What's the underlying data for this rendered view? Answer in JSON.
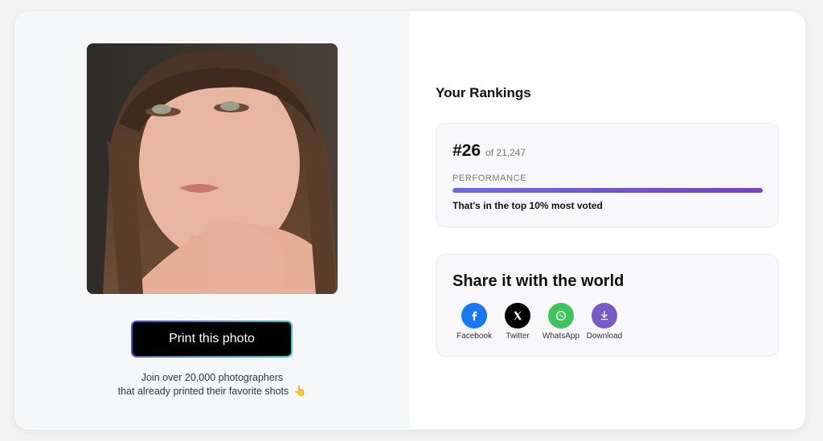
{
  "left": {
    "print_button_label": "Print this photo",
    "join_line1": "Join over 20,000 photographers",
    "join_line2": "that already printed their favorite shots",
    "join_emoji": "👆"
  },
  "rankings": {
    "title": "Your Rankings",
    "rank": "#26",
    "of_total": "of 21,247",
    "performance_label": "PERFORMANCE",
    "performance_fraction": 1.0,
    "performance_text": "That's in the top 10% most voted"
  },
  "share": {
    "title": "Share it with the world",
    "items": [
      {
        "label": "Facebook",
        "icon": "facebook-icon",
        "color": "#1877f2"
      },
      {
        "label": "Twitter",
        "icon": "x-icon",
        "color": "#000000"
      },
      {
        "label": "WhatsApp",
        "icon": "whatsapp-icon",
        "color": "#3fc35c"
      },
      {
        "label": "Download",
        "icon": "download-icon",
        "color": "#7a5ac8"
      }
    ]
  }
}
